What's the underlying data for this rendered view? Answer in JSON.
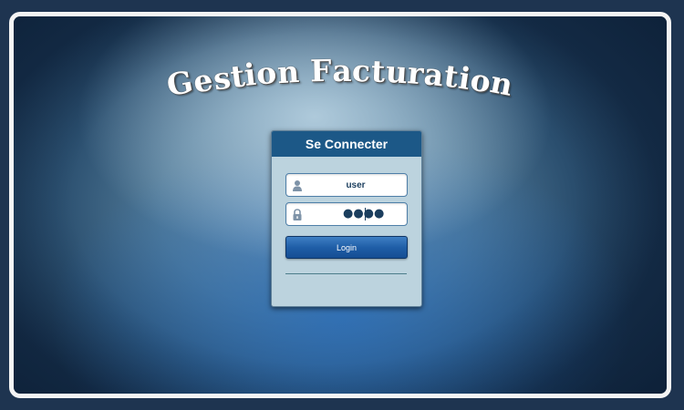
{
  "app": {
    "title": "Gestion Facturation"
  },
  "login": {
    "header": "Se Connecter",
    "username": {
      "value": "user",
      "icon": "user-icon"
    },
    "password": {
      "masked_value": "●●●●",
      "icon": "lock-icon"
    },
    "button_label": "Login"
  },
  "colors": {
    "header": "#1c5887",
    "panel": "#bcd3de",
    "button": "#1f5ea7",
    "frame": "#f4f4f4"
  }
}
